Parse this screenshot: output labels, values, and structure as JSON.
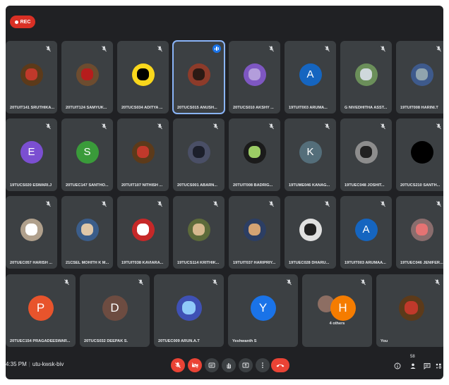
{
  "rec_label": "REC",
  "participants_row1": [
    {
      "name": "20TUIT141 SRUTHIKA...",
      "initial": "",
      "color": "#5c3a1a",
      "inner": "#c0392b"
    },
    {
      "name": "20TUIT124 SAMYUK...",
      "initial": "",
      "color": "#6d4c2f",
      "inner": "#b71c1c"
    },
    {
      "name": "20TUCS034 ADITYA ...",
      "initial": "",
      "color": "#f9d71c",
      "inner": "#000000"
    },
    {
      "name": "20TUCS015 ANUSH...",
      "initial": "",
      "color": "#8d3b2a",
      "inner": "#2b1a14"
    },
    {
      "name": "20TUCS010 AKSHY ...",
      "initial": "",
      "color": "#7e57c2",
      "inner": "#b39ddb"
    },
    {
      "name": "19TUIT003 ARUMA...",
      "initial": "A",
      "color": "#1565c0",
      "inner": ""
    },
    {
      "name": "G NIVEDHITHA ASST...",
      "initial": "",
      "color": "#6b8f5a",
      "inner": "#cfd8dc"
    },
    {
      "name": "19TUIT008 HARINI.T",
      "initial": "",
      "color": "#3e5a8c",
      "inner": "#90a4ae"
    }
  ],
  "participants_row2": [
    {
      "name": "19TUCS020 ESWARI.J",
      "initial": "E",
      "color": "#7b4fd1",
      "inner": ""
    },
    {
      "name": "20TUEC147 SANTHO...",
      "initial": "S",
      "color": "#3a9b3a",
      "inner": ""
    },
    {
      "name": "20TUIT107 NITHISH ...",
      "initial": "",
      "color": "#5c3a1a",
      "inner": "#c0392b"
    },
    {
      "name": "20TUCS001 ABARN...",
      "initial": "",
      "color": "#4a4f66",
      "inner": "#1c1f2b"
    },
    {
      "name": "20TUIT008 BADRIG...",
      "initial": "",
      "color": "#1b1b1b",
      "inner": "#9ccc65"
    },
    {
      "name": "19TUME046 KANAG...",
      "initial": "K",
      "color": "#546e7a",
      "inner": ""
    },
    {
      "name": "19TUEC048 JOSHIT...",
      "initial": "",
      "color": "#8d8d8d",
      "inner": "#212121"
    },
    {
      "name": "20TUCS210 SANTH...",
      "initial": "",
      "color": "#000000",
      "inner": "#000000"
    }
  ],
  "participants_row3": [
    {
      "name": "20TUEC057 HARISH ...",
      "initial": "",
      "color": "#b0a08c",
      "inner": "#ffffff"
    },
    {
      "name": "21CSEL MOHITH K M...",
      "initial": "",
      "color": "#3b5d8a",
      "inner": "#e0c7a8"
    },
    {
      "name": "19TUIT038 KAVIARA...",
      "initial": "",
      "color": "#c62828",
      "inner": "#ffffff"
    },
    {
      "name": "19TUCS114 KRITHIK...",
      "initial": "",
      "color": "#5d6b3a",
      "inner": "#d7b98e"
    },
    {
      "name": "19TUIT037 HARIPRIY...",
      "initial": "",
      "color": "#2c3e63",
      "inner": "#d4a373"
    },
    {
      "name": "19TUEC028 DHARU...",
      "initial": "",
      "color": "#e0e0e0",
      "inner": "#212121"
    },
    {
      "name": "19TUIT003 ARUMAA...",
      "initial": "A",
      "color": "#1565c0",
      "inner": ""
    },
    {
      "name": "19TUEC046 JENIFER...",
      "initial": "",
      "color": "#8a6d6d",
      "inner": "#e57373"
    }
  ],
  "participants_row4": [
    {
      "name": "20TUEC154 PRAGADEESWAR...",
      "initial": "P",
      "color": "#e8542c",
      "inner": ""
    },
    {
      "name": "20TUCS032 DEEPAK S.",
      "initial": "D",
      "color": "#6d4c41",
      "inner": ""
    },
    {
      "name": "20TUEC009 ARUN.A.T",
      "initial": "",
      "color": "#3f51b5",
      "inner": "#90caf9"
    },
    {
      "name": "Yeshwanth S",
      "initial": "Y",
      "color": "#1a73e8",
      "inner": ""
    },
    {
      "name": "4 others",
      "initial": "H",
      "color": "#f57c00",
      "inner": ""
    },
    {
      "name": "You",
      "initial": "",
      "color": "#5c3a1a",
      "inner": "#c0392b"
    }
  ],
  "bottom": {
    "time": "4:35 PM",
    "meeting_code": "utu-kwsk-biv"
  },
  "controls": [
    "mic-off",
    "camera-off",
    "captions",
    "raise-hand",
    "present",
    "more-options",
    "end-call"
  ],
  "right_controls": [
    "info",
    "people",
    "chat",
    "activities"
  ],
  "people_count": "58"
}
